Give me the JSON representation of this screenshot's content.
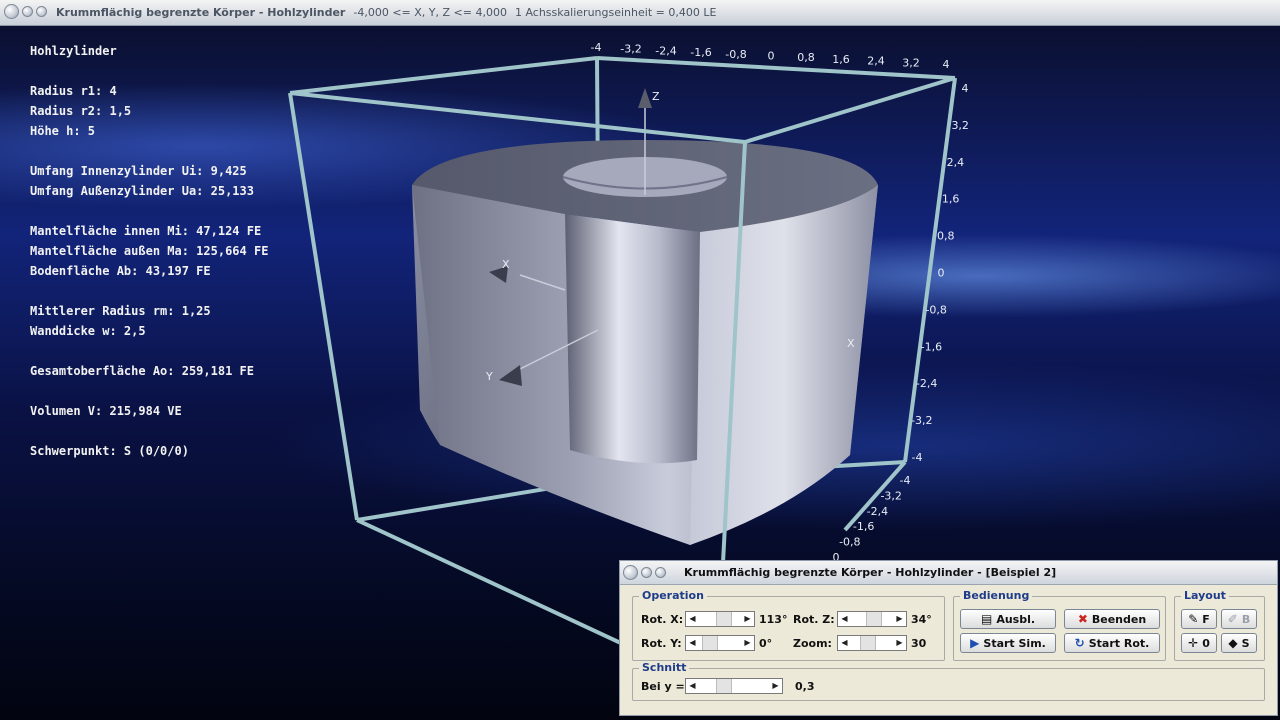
{
  "window": {
    "title": "Krummflächig begrenzte Körper - Hohlzylinder",
    "range_text": "-4,000 <= X, Y, Z <= 4,000",
    "scale_text": "1 Achsskalierungseinheit = 0,400 LE"
  },
  "info": {
    "heading": "Hohlzylinder",
    "lines": [
      "Radius r1: 4",
      "Radius r2: 1,5",
      "Höhe h: 5",
      "Umfang Innenzylinder Ui: 9,425",
      "Umfang Außenzylinder Ua: 25,133",
      "Mantelfläche innen Mi: 47,124 FE",
      "Mantelfläche außen Ma: 125,664 FE",
      "Bodenfläche Ab: 43,197 FE",
      "Mittlerer Radius rm: 1,25",
      "Wanddicke w: 2,5",
      "Gesamtoberfläche Ao: 259,181 FE",
      "Volumen V: 215,984 VE",
      "Schwerpunkt: S (0/0/0)"
    ]
  },
  "axes": {
    "top_ticks": [
      "-4",
      "-3,2",
      "-2,4",
      "-1,6",
      "-0,8",
      "0",
      "0,8",
      "1,6",
      "2,4",
      "3,2",
      "4"
    ],
    "right_ticks": [
      "4",
      "3,2",
      "2,4",
      "1,6",
      "0,8",
      "0",
      "-0,8",
      "-1,6",
      "-2,4",
      "-3,2",
      "-4"
    ],
    "diag_ticks": [
      "-4",
      "-3,2",
      "-2,4",
      "-1,6",
      "-0,8",
      "0"
    ],
    "x_label": "X",
    "y_label": "Y",
    "z_label": "Z",
    "x_label_right": "X"
  },
  "dialog": {
    "title": "Krummflächig begrenzte Körper - Hohlzylinder - [Beispiel 2]",
    "operation": {
      "legend": "Operation",
      "rot_x_label": "Rot. X:",
      "rot_x_value": "113°",
      "rot_y_label": "Rot. Y:",
      "rot_y_value": "0°",
      "rot_z_label": "Rot. Z:",
      "rot_z_value": "34°",
      "zoom_label": "Zoom:",
      "zoom_value": "30"
    },
    "bedienung": {
      "legend": "Bedienung",
      "ausbl": "Ausbl.",
      "beenden": "Beenden",
      "start_sim": "Start Sim.",
      "start_rot": "Start Rot."
    },
    "layout": {
      "legend": "Layout",
      "f": "F",
      "b": "B",
      "o": "0",
      "s": "S"
    },
    "schnitt": {
      "legend": "Schnitt",
      "label": "Bei y =",
      "value": "0,3"
    }
  },
  "colors": {
    "frame": "#9fc4c9",
    "solid_light": "#d4d8e6",
    "solid_dark": "#55586a"
  }
}
